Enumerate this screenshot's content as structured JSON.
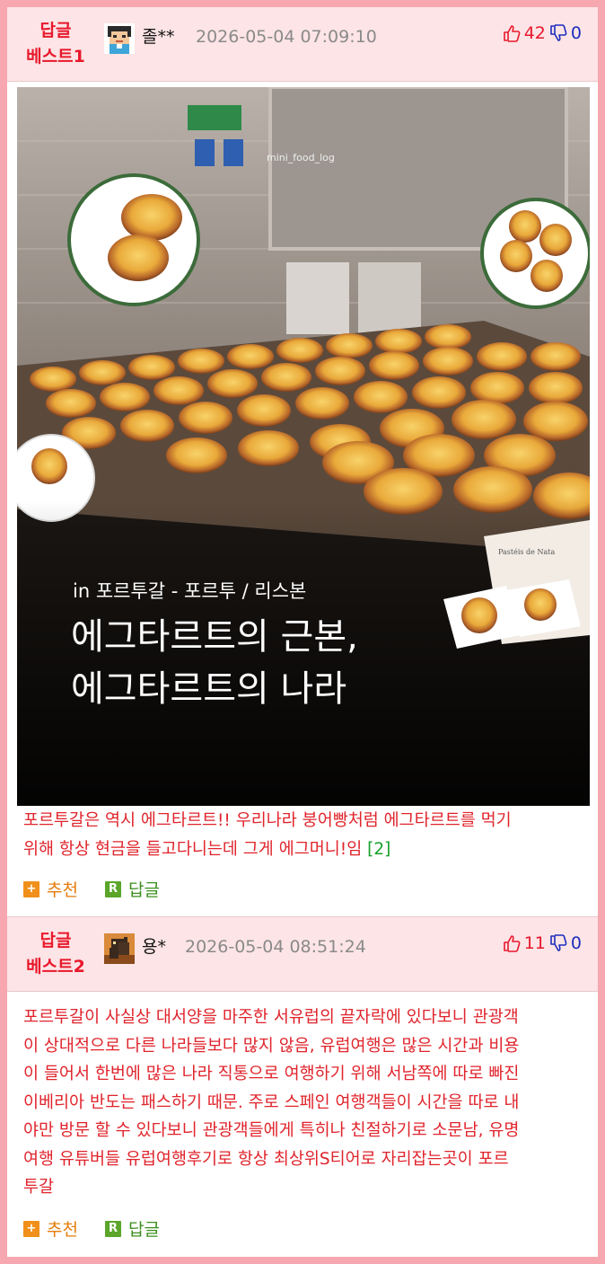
{
  "comments": [
    {
      "best_label_1": "답글",
      "best_label_2": "베스트1",
      "nickname": "졸**",
      "date": "2026-05-04 07:09:10",
      "upvotes": "42",
      "downvotes": "0",
      "image": {
        "watermark": "mini_food_log",
        "caption_small": "in 포르투갈 - 포르투 / 리스본",
        "caption_line1": "에그타르트의 근본,",
        "caption_line2": "에그타르트의 나라",
        "sign_text": "Pastéis de Nata"
      },
      "text_line1": "포르투갈은 역시 에그타르트!! 우리나라 붕어빵처럼 에그타르트를 먹기",
      "text_line2": "위해 항상 현금을 들고다니는데 그게 에그머니!임",
      "reply_count": "[2]",
      "recommend_label": "추천",
      "reply_label": "답글"
    },
    {
      "best_label_1": "답글",
      "best_label_2": "베스트2",
      "nickname": "용*",
      "date": "2026-05-04 08:51:24",
      "upvotes": "11",
      "downvotes": "0",
      "lines": [
        "포르투갈이 사실상 대서양을 마주한 서유럽의 끝자락에 있다보니 관광객",
        "이 상대적으로 다른 나라들보다 많지 않음, 유럽여행은 많은 시간과 비용",
        "이 들어서 한번에 많은 나라 직통으로 여행하기 위해 서남쪽에 따로 빠진",
        "이베리아 반도는 패스하기 때문. 주로 스페인 여행객들이 시간을 따로 내",
        "야만 방문 할 수 있다보니 관광객들에게 특히나 친절하기로 소문남, 유명",
        "여행 유튜버들 유럽여행후기로 항상 최상위S티어로 자리잡는곳이 포르",
        "투갈"
      ],
      "recommend_label": "추천",
      "reply_label": "답글"
    }
  ],
  "icons": {
    "recommend": "plus-icon",
    "reply": "r-reply-icon",
    "upvote": "thumbs-up-icon",
    "downvote": "thumbs-down-icon"
  },
  "colors": {
    "frame": "#f7a7b0",
    "header_bg": "#fde4e6",
    "best_red": "#e8182c",
    "comment_red": "#e0242c",
    "down_blue": "#1c2dbd",
    "reply_green": "#3b8f1e",
    "recommend_orange": "#e67d0c"
  }
}
